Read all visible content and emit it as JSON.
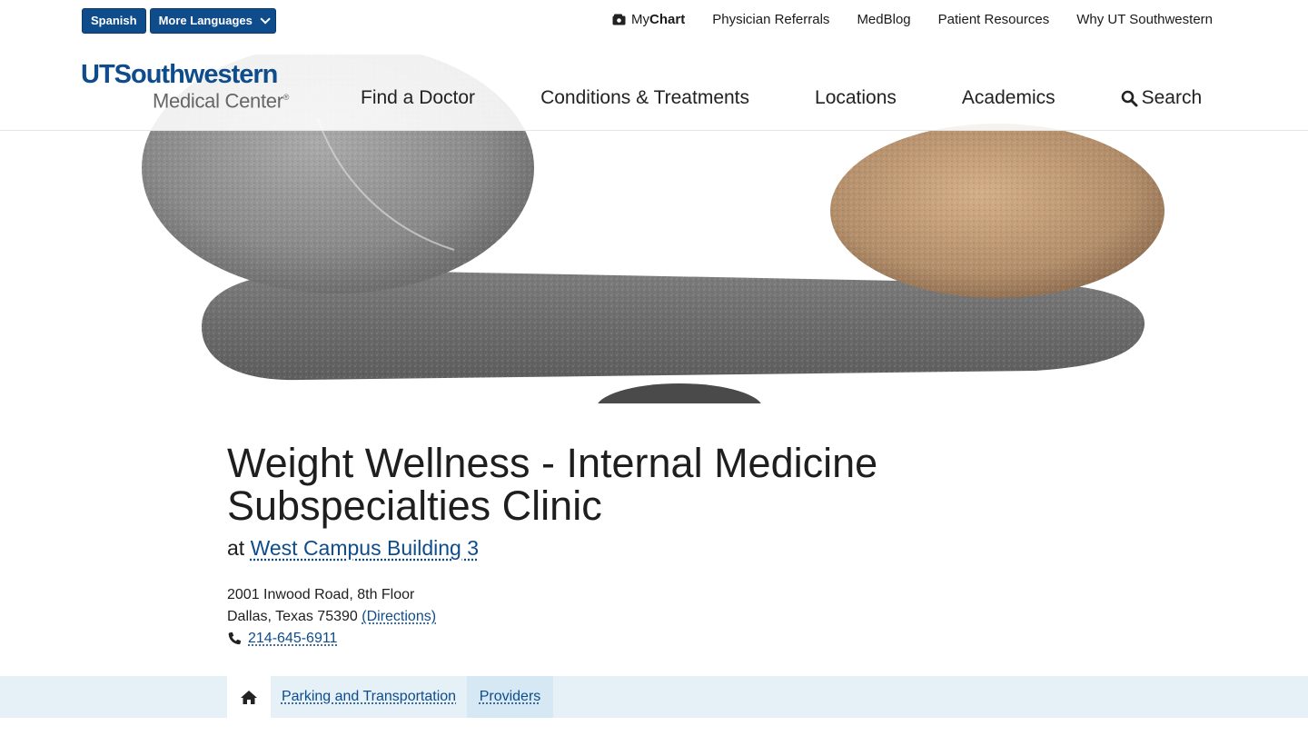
{
  "language_bar": {
    "spanish_label": "Spanish",
    "more_languages_label": "More Languages"
  },
  "utility_nav": {
    "mychart_prefix": "My",
    "mychart_bold": "Chart",
    "items": [
      "Physician Referrals",
      "MedBlog",
      "Patient Resources",
      "Why UT Southwestern"
    ]
  },
  "logo": {
    "line1": "UTSouthwestern",
    "line2": "Medical Center"
  },
  "main_nav": {
    "items": [
      "Find a Doctor",
      "Conditions & Treatments",
      "Locations",
      "Academics"
    ],
    "search_label": "Search"
  },
  "clinic": {
    "title": "Weight Wellness - Internal Medicine Subspecialties Clinic",
    "at_prefix": "at",
    "building": "West Campus Building 3",
    "address_line1": "2001 Inwood Road, 8th Floor",
    "address_line2": "Dallas, Texas 75390",
    "directions_label": "(Directions)",
    "phone": "214-645-6911"
  },
  "tabs": {
    "parking_label": "Parking and Transportation",
    "providers_label": "Providers"
  },
  "colors": {
    "brand_blue": "#0e4c8c",
    "tab_bar_bg": "#e5f0f7"
  }
}
